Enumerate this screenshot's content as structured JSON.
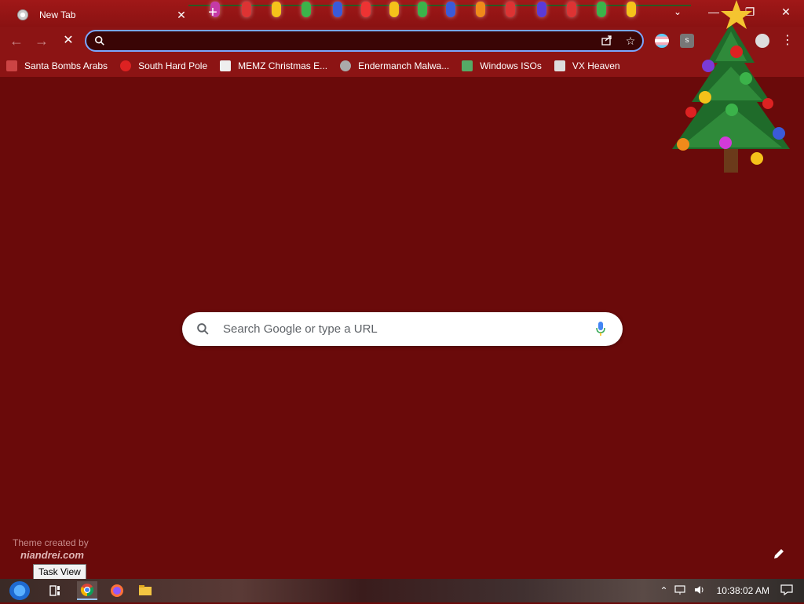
{
  "browser": {
    "tab": {
      "title": "New Tab",
      "close_glyph": "✕"
    },
    "new_tab_glyph": "+",
    "window_controls": {
      "tab_search": "⌄",
      "minimize": "—",
      "restore": "❐",
      "close": "✕"
    },
    "nav": {
      "back": "←",
      "forward": "→",
      "stop": "✕"
    },
    "omnibox": {
      "value": "",
      "placeholder": ""
    },
    "menu_glyph": "⋮",
    "extension_icons": [
      "pride-flag-extension-icon",
      "s-extension-icon",
      "puzzle-extensions-icon",
      "profile-avatar-icon"
    ]
  },
  "bookmarks": [
    {
      "label": "Santa Bombs Arabs",
      "icon": "santa-bookmark-icon",
      "color": "#c44"
    },
    {
      "label": "South Hard Pole",
      "icon": "red-snowflake-icon",
      "color": "#d22"
    },
    {
      "label": "MEMZ Christmas E...",
      "icon": "memz-bookmark-icon",
      "color": "#eee"
    },
    {
      "label": "Endermanch Malwa...",
      "icon": "raccoon-bookmark-icon",
      "color": "#aaa"
    },
    {
      "label": "Windows ISOs",
      "icon": "tree-bookmark-icon",
      "color": "#5a6"
    },
    {
      "label": "VX Heaven",
      "icon": "shield-bookmark-icon",
      "color": "#ddd"
    }
  ],
  "ntp": {
    "search_placeholder": "Search Google or type a URL",
    "theme_credit_line1": "Theme created by",
    "theme_credit_line2": "niandrei.com"
  },
  "tooltip": "Task View",
  "taskbar": {
    "clock": "10:38:02 AM",
    "tray_chevron": "⌃"
  },
  "colors": {
    "background": "#6a0a0a",
    "toolbar": "#8c1414",
    "omnibox_focus": "#7aa7ff"
  }
}
